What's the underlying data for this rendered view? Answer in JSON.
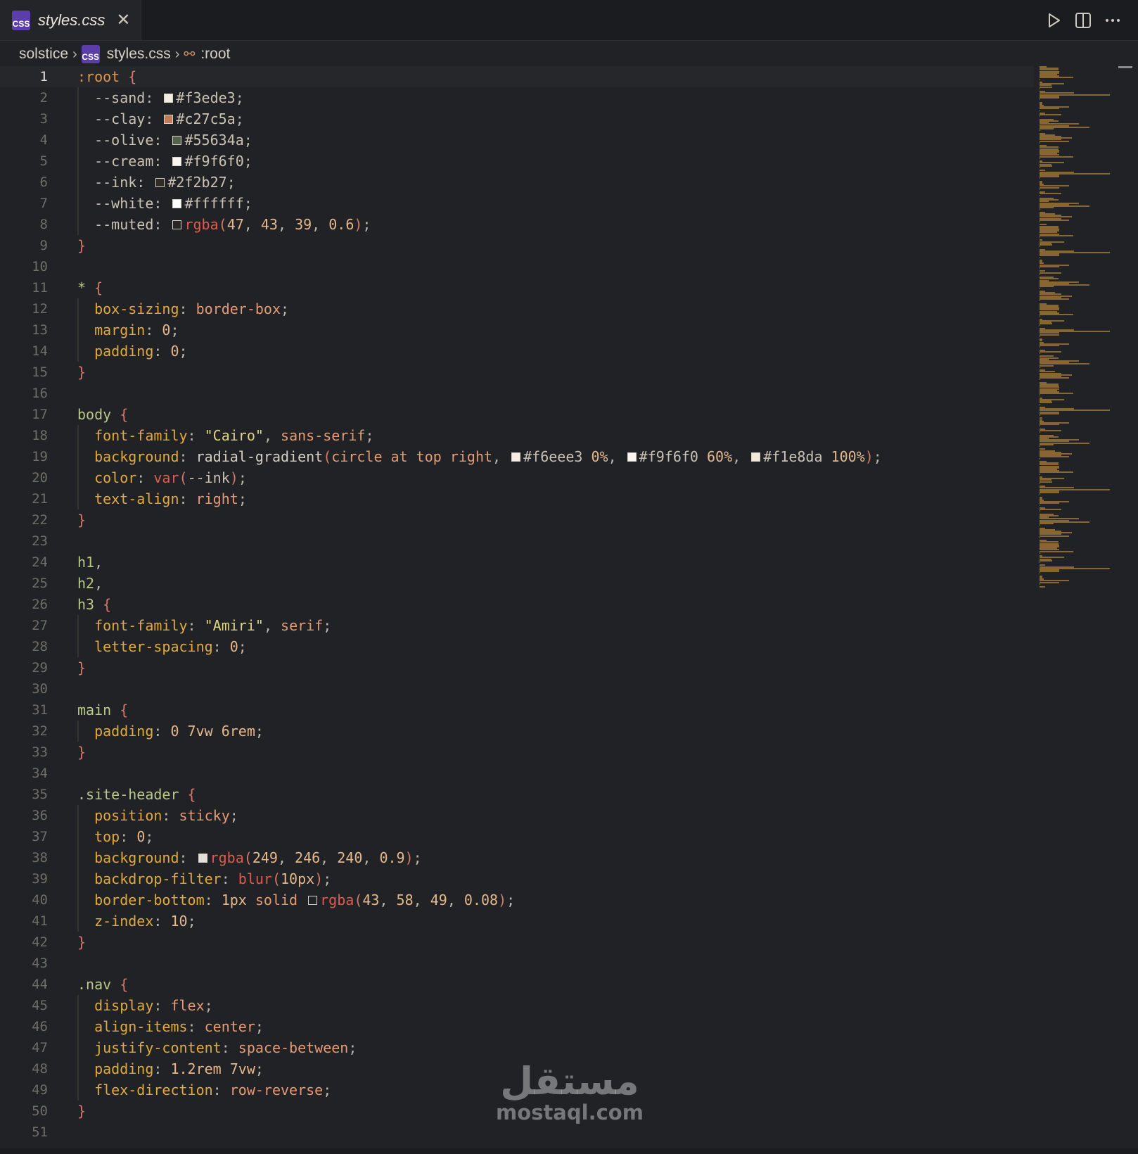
{
  "tab": {
    "title": "styles.css",
    "icon": "CSS"
  },
  "breadcrumb": {
    "folder": "solstice",
    "file": "styles.css",
    "symbol": ":root"
  },
  "watermark": {
    "arabic": "مستقل",
    "latin": "mostaql.com"
  },
  "colors": {
    "background": "#212225",
    "sand": "#f3ede3",
    "clay": "#c27c5a",
    "olive": "#55634a",
    "cream": "#f9f6f0",
    "ink": "#2f2b27",
    "white": "#ffffff"
  },
  "lines": [
    {
      "n": "1",
      "active": true,
      "tokens": [
        [
          "k-root",
          ":root"
        ],
        [
          "k-plain",
          " "
        ],
        [
          "k-brace",
          "{"
        ]
      ]
    },
    {
      "n": "2",
      "guide": true,
      "tokens": [
        [
          "k-var",
          "  --sand"
        ],
        [
          "k-punc",
          ": "
        ],
        [
          "sw",
          "#f3ede3"
        ],
        [
          "k-var",
          "#f3ede3"
        ],
        [
          "k-punc",
          ";"
        ]
      ]
    },
    {
      "n": "3",
      "guide": true,
      "tokens": [
        [
          "k-var",
          "  --clay"
        ],
        [
          "k-punc",
          ": "
        ],
        [
          "sw",
          "#c27c5a"
        ],
        [
          "k-var",
          "#c27c5a"
        ],
        [
          "k-punc",
          ";"
        ]
      ]
    },
    {
      "n": "4",
      "guide": true,
      "tokens": [
        [
          "k-var",
          "  --olive"
        ],
        [
          "k-punc",
          ": "
        ],
        [
          "sw",
          "#55634a"
        ],
        [
          "k-var",
          "#55634a"
        ],
        [
          "k-punc",
          ";"
        ]
      ]
    },
    {
      "n": "5",
      "guide": true,
      "tokens": [
        [
          "k-var",
          "  --cream"
        ],
        [
          "k-punc",
          ": "
        ],
        [
          "sw",
          "#f9f6f0"
        ],
        [
          "k-var",
          "#f9f6f0"
        ],
        [
          "k-punc",
          ";"
        ]
      ]
    },
    {
      "n": "6",
      "guide": true,
      "tokens": [
        [
          "k-var",
          "  --ink"
        ],
        [
          "k-punc",
          ": "
        ],
        [
          "sw",
          "#2f2b27"
        ],
        [
          "k-var",
          "#2f2b27"
        ],
        [
          "k-punc",
          ";"
        ]
      ]
    },
    {
      "n": "7",
      "guide": true,
      "tokens": [
        [
          "k-var",
          "  --white"
        ],
        [
          "k-punc",
          ": "
        ],
        [
          "sw",
          "#ffffff"
        ],
        [
          "k-var",
          "#ffffff"
        ],
        [
          "k-punc",
          ";"
        ]
      ]
    },
    {
      "n": "8",
      "guide": true,
      "tokens": [
        [
          "k-var",
          "  --muted"
        ],
        [
          "k-punc",
          ": "
        ],
        [
          "sw",
          "rgba(47,43,39,0.6)"
        ],
        [
          "k-fn",
          "rgba"
        ],
        [
          "k-brace",
          "("
        ],
        [
          "k-num",
          "47"
        ],
        [
          "k-punc",
          ", "
        ],
        [
          "k-num",
          "43"
        ],
        [
          "k-punc",
          ", "
        ],
        [
          "k-num",
          "39"
        ],
        [
          "k-punc",
          ", "
        ],
        [
          "k-num",
          "0.6"
        ],
        [
          "k-brace",
          ")"
        ],
        [
          "k-punc",
          ";"
        ]
      ]
    },
    {
      "n": "9",
      "tokens": [
        [
          "k-brace",
          "}"
        ]
      ]
    },
    {
      "n": "10",
      "tokens": []
    },
    {
      "n": "11",
      "tokens": [
        [
          "k-sel",
          "*"
        ],
        [
          "k-plain",
          " "
        ],
        [
          "k-brace",
          "{"
        ]
      ]
    },
    {
      "n": "12",
      "guide": true,
      "tokens": [
        [
          "k-prop",
          "  box-sizing"
        ],
        [
          "k-punc",
          ": "
        ],
        [
          "k-val",
          "border-box"
        ],
        [
          "k-punc",
          ";"
        ]
      ]
    },
    {
      "n": "13",
      "guide": true,
      "tokens": [
        [
          "k-prop",
          "  margin"
        ],
        [
          "k-punc",
          ": "
        ],
        [
          "k-num",
          "0"
        ],
        [
          "k-punc",
          ";"
        ]
      ]
    },
    {
      "n": "14",
      "guide": true,
      "tokens": [
        [
          "k-prop",
          "  padding"
        ],
        [
          "k-punc",
          ": "
        ],
        [
          "k-num",
          "0"
        ],
        [
          "k-punc",
          ";"
        ]
      ]
    },
    {
      "n": "15",
      "tokens": [
        [
          "k-brace",
          "}"
        ]
      ]
    },
    {
      "n": "16",
      "tokens": []
    },
    {
      "n": "17",
      "tokens": [
        [
          "k-sel",
          "body"
        ],
        [
          "k-plain",
          " "
        ],
        [
          "k-brace",
          "{"
        ]
      ]
    },
    {
      "n": "18",
      "guide": true,
      "tokens": [
        [
          "k-prop",
          "  font-family"
        ],
        [
          "k-punc",
          ": "
        ],
        [
          "k-str",
          "\"Cairo\""
        ],
        [
          "k-punc",
          ", "
        ],
        [
          "k-val",
          "sans-serif"
        ],
        [
          "k-punc",
          ";"
        ]
      ]
    },
    {
      "n": "19",
      "guide": true,
      "tokens": [
        [
          "k-prop",
          "  background"
        ],
        [
          "k-punc",
          ": "
        ],
        [
          "k-plain",
          "radial-gradient"
        ],
        [
          "k-brace",
          "("
        ],
        [
          "k-val",
          "circle at top right"
        ],
        [
          "k-punc",
          ", "
        ],
        [
          "sw",
          "#f6eee3"
        ],
        [
          "k-var",
          "#f6eee3"
        ],
        [
          "k-num",
          " 0%"
        ],
        [
          "k-punc",
          ", "
        ],
        [
          "sw",
          "#f9f6f0"
        ],
        [
          "k-var",
          "#f9f6f0"
        ],
        [
          "k-num",
          " 60%"
        ],
        [
          "k-punc",
          ", "
        ],
        [
          "sw",
          "#f1e8da"
        ],
        [
          "k-var",
          "#f1e8da"
        ],
        [
          "k-num",
          " 100%"
        ],
        [
          "k-brace",
          ")"
        ],
        [
          "k-punc",
          ";"
        ]
      ]
    },
    {
      "n": "20",
      "guide": true,
      "tokens": [
        [
          "k-prop",
          "  color"
        ],
        [
          "k-punc",
          ": "
        ],
        [
          "k-fn",
          "var"
        ],
        [
          "k-brace",
          "("
        ],
        [
          "k-var",
          "--ink"
        ],
        [
          "k-brace",
          ")"
        ],
        [
          "k-punc",
          ";"
        ]
      ]
    },
    {
      "n": "21",
      "guide": true,
      "tokens": [
        [
          "k-prop",
          "  text-align"
        ],
        [
          "k-punc",
          ": "
        ],
        [
          "k-val",
          "right"
        ],
        [
          "k-punc",
          ";"
        ]
      ]
    },
    {
      "n": "22",
      "tokens": [
        [
          "k-brace",
          "}"
        ]
      ]
    },
    {
      "n": "23",
      "tokens": []
    },
    {
      "n": "24",
      "tokens": [
        [
          "k-sel",
          "h1"
        ],
        [
          "k-punc",
          ","
        ]
      ]
    },
    {
      "n": "25",
      "tokens": [
        [
          "k-sel",
          "h2"
        ],
        [
          "k-punc",
          ","
        ]
      ]
    },
    {
      "n": "26",
      "tokens": [
        [
          "k-sel",
          "h3"
        ],
        [
          "k-plain",
          " "
        ],
        [
          "k-brace",
          "{"
        ]
      ]
    },
    {
      "n": "27",
      "guide": true,
      "tokens": [
        [
          "k-prop",
          "  font-family"
        ],
        [
          "k-punc",
          ": "
        ],
        [
          "k-str",
          "\"Amiri\""
        ],
        [
          "k-punc",
          ", "
        ],
        [
          "k-val",
          "serif"
        ],
        [
          "k-punc",
          ";"
        ]
      ]
    },
    {
      "n": "28",
      "guide": true,
      "tokens": [
        [
          "k-prop",
          "  letter-spacing"
        ],
        [
          "k-punc",
          ": "
        ],
        [
          "k-num",
          "0"
        ],
        [
          "k-punc",
          ";"
        ]
      ]
    },
    {
      "n": "29",
      "tokens": [
        [
          "k-brace",
          "}"
        ]
      ]
    },
    {
      "n": "30",
      "tokens": []
    },
    {
      "n": "31",
      "tokens": [
        [
          "k-sel",
          "main"
        ],
        [
          "k-plain",
          " "
        ],
        [
          "k-brace",
          "{"
        ]
      ]
    },
    {
      "n": "32",
      "guide": true,
      "tokens": [
        [
          "k-prop",
          "  padding"
        ],
        [
          "k-punc",
          ": "
        ],
        [
          "k-num",
          "0 7vw 6rem"
        ],
        [
          "k-punc",
          ";"
        ]
      ]
    },
    {
      "n": "33",
      "tokens": [
        [
          "k-brace",
          "}"
        ]
      ]
    },
    {
      "n": "34",
      "tokens": []
    },
    {
      "n": "35",
      "tokens": [
        [
          "k-sel",
          ".site-header"
        ],
        [
          "k-plain",
          " "
        ],
        [
          "k-brace",
          "{"
        ]
      ]
    },
    {
      "n": "36",
      "guide": true,
      "tokens": [
        [
          "k-prop",
          "  position"
        ],
        [
          "k-punc",
          ": "
        ],
        [
          "k-val",
          "sticky"
        ],
        [
          "k-punc",
          ";"
        ]
      ]
    },
    {
      "n": "37",
      "guide": true,
      "tokens": [
        [
          "k-prop",
          "  top"
        ],
        [
          "k-punc",
          ": "
        ],
        [
          "k-num",
          "0"
        ],
        [
          "k-punc",
          ";"
        ]
      ]
    },
    {
      "n": "38",
      "guide": true,
      "tokens": [
        [
          "k-prop",
          "  background"
        ],
        [
          "k-punc",
          ": "
        ],
        [
          "sw",
          "rgba(249,246,240,0.9)"
        ],
        [
          "k-fn",
          "rgba"
        ],
        [
          "k-brace",
          "("
        ],
        [
          "k-num",
          "249"
        ],
        [
          "k-punc",
          ", "
        ],
        [
          "k-num",
          "246"
        ],
        [
          "k-punc",
          ", "
        ],
        [
          "k-num",
          "240"
        ],
        [
          "k-punc",
          ", "
        ],
        [
          "k-num",
          "0.9"
        ],
        [
          "k-brace",
          ")"
        ],
        [
          "k-punc",
          ";"
        ]
      ]
    },
    {
      "n": "39",
      "guide": true,
      "tokens": [
        [
          "k-prop",
          "  backdrop-filter"
        ],
        [
          "k-punc",
          ": "
        ],
        [
          "k-fn",
          "blur"
        ],
        [
          "k-brace",
          "("
        ],
        [
          "k-num",
          "10px"
        ],
        [
          "k-brace",
          ")"
        ],
        [
          "k-punc",
          ";"
        ]
      ]
    },
    {
      "n": "40",
      "guide": true,
      "tokens": [
        [
          "k-prop",
          "  border-bottom"
        ],
        [
          "k-punc",
          ": "
        ],
        [
          "k-num",
          "1px "
        ],
        [
          "k-val",
          "solid "
        ],
        [
          "sw",
          "rgba(43,58,49,0.08)"
        ],
        [
          "k-fn",
          "rgba"
        ],
        [
          "k-brace",
          "("
        ],
        [
          "k-num",
          "43"
        ],
        [
          "k-punc",
          ", "
        ],
        [
          "k-num",
          "58"
        ],
        [
          "k-punc",
          ", "
        ],
        [
          "k-num",
          "49"
        ],
        [
          "k-punc",
          ", "
        ],
        [
          "k-num",
          "0.08"
        ],
        [
          "k-brace",
          ")"
        ],
        [
          "k-punc",
          ";"
        ]
      ]
    },
    {
      "n": "41",
      "guide": true,
      "tokens": [
        [
          "k-prop",
          "  z-index"
        ],
        [
          "k-punc",
          ": "
        ],
        [
          "k-num",
          "10"
        ],
        [
          "k-punc",
          ";"
        ]
      ]
    },
    {
      "n": "42",
      "tokens": [
        [
          "k-brace",
          "}"
        ]
      ]
    },
    {
      "n": "43",
      "tokens": []
    },
    {
      "n": "44",
      "tokens": [
        [
          "k-sel",
          ".nav"
        ],
        [
          "k-plain",
          " "
        ],
        [
          "k-brace",
          "{"
        ]
      ]
    },
    {
      "n": "45",
      "guide": true,
      "tokens": [
        [
          "k-prop",
          "  display"
        ],
        [
          "k-punc",
          ": "
        ],
        [
          "k-val",
          "flex"
        ],
        [
          "k-punc",
          ";"
        ]
      ]
    },
    {
      "n": "46",
      "guide": true,
      "tokens": [
        [
          "k-prop",
          "  align-items"
        ],
        [
          "k-punc",
          ": "
        ],
        [
          "k-val",
          "center"
        ],
        [
          "k-punc",
          ";"
        ]
      ]
    },
    {
      "n": "47",
      "guide": true,
      "tokens": [
        [
          "k-prop",
          "  justify-content"
        ],
        [
          "k-punc",
          ": "
        ],
        [
          "k-val",
          "space-between"
        ],
        [
          "k-punc",
          ";"
        ]
      ]
    },
    {
      "n": "48",
      "guide": true,
      "tokens": [
        [
          "k-prop",
          "  padding"
        ],
        [
          "k-punc",
          ": "
        ],
        [
          "k-num",
          "1.2rem 7vw"
        ],
        [
          "k-punc",
          ";"
        ]
      ]
    },
    {
      "n": "49",
      "guide": true,
      "tokens": [
        [
          "k-prop",
          "  flex-direction"
        ],
        [
          "k-punc",
          ": "
        ],
        [
          "k-val",
          "row-reverse"
        ],
        [
          "k-punc",
          ";"
        ]
      ]
    },
    {
      "n": "50",
      "tokens": [
        [
          "k-brace",
          "}"
        ]
      ]
    },
    {
      "n": "51",
      "tokens": []
    }
  ]
}
